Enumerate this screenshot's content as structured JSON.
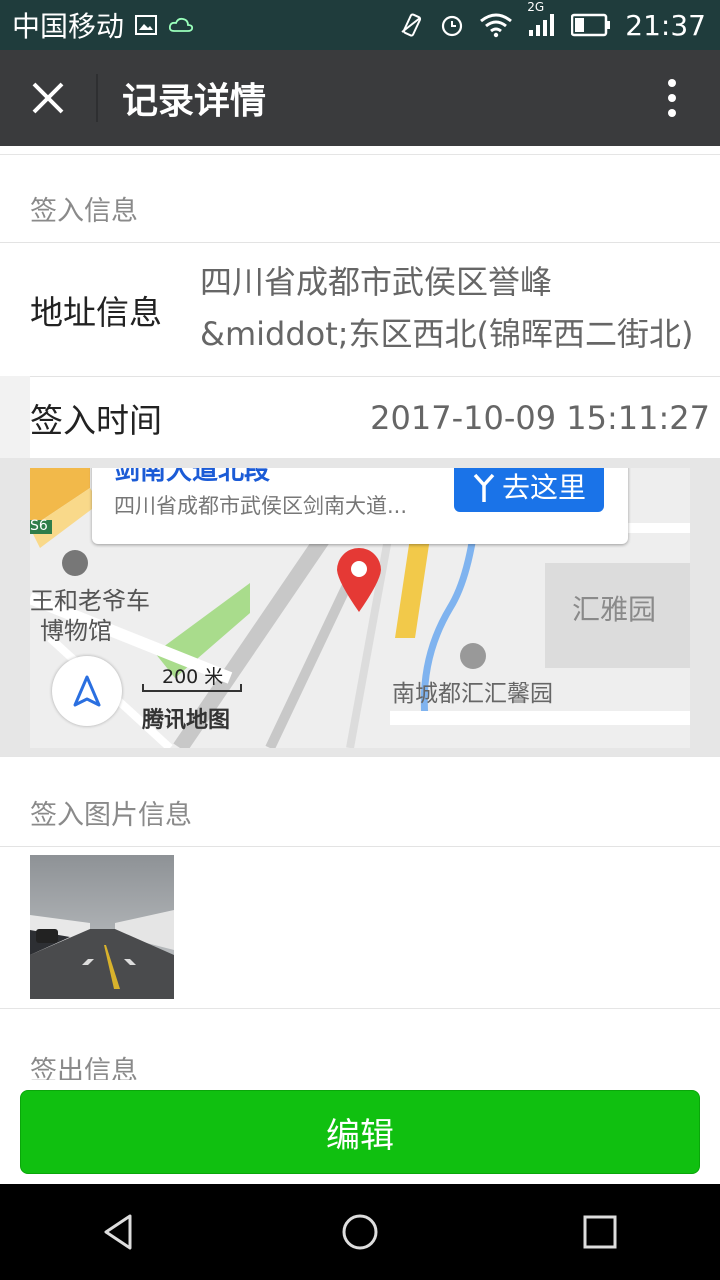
{
  "status_bar": {
    "carrier": "中国移动",
    "network": "2G",
    "time": "21:37"
  },
  "header": {
    "title": "记录详情"
  },
  "checkin": {
    "section_title": "签入信息",
    "address_label": "地址信息",
    "address_value_line1": "四川省成都市武侯区誉峰",
    "address_value_line2": "&middot;东区西北(锦晖西二街北)",
    "time_label": "签入时间",
    "time_value": "2017-10-09 15:11:27"
  },
  "map": {
    "popup_title": "剑南大道北段",
    "popup_address": "四川省成都市武侯区剑南大道...",
    "go_button": "去这里",
    "labels": {
      "museum": "王和老爷车",
      "museum2": "博物馆",
      "area1": "汇雅园",
      "area2": "南城都汇汇馨园",
      "road": "S6"
    },
    "scale": "200 米",
    "brand": "腾讯地图"
  },
  "photo_section": {
    "title": "签入图片信息"
  },
  "checkout": {
    "section_title": "签出信息"
  },
  "footer": {
    "edit_button": "编辑"
  },
  "icons": {
    "close": "close-icon",
    "more": "more-vertical-icon",
    "locate": "navigation-arrow-icon",
    "pin": "map-pin-icon",
    "back": "nav-back-icon",
    "home": "nav-home-icon",
    "recent": "nav-recent-icon"
  },
  "colors": {
    "header_bg": "#3a3b3d",
    "button_green": "#10c010",
    "map_button_blue": "#1a73e8",
    "pin_red": "#e53935"
  }
}
